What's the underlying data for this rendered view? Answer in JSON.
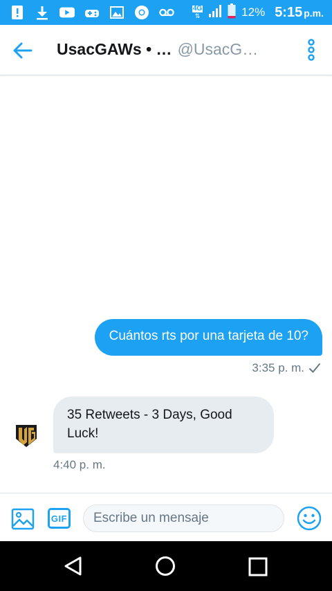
{
  "status_bar": {
    "icons": [
      "alert-icon",
      "download-icon",
      "youtube-icon",
      "games-icon",
      "gallery-icon",
      "chrome-icon",
      "voicemail-icon",
      "network-4g-icon",
      "signal-icon",
      "battery-icon"
    ],
    "network_type": "4G",
    "battery_percent": "12%",
    "time": "5:15",
    "ampm": "p.m.",
    "background_color": "#1da1f2"
  },
  "header": {
    "name": "UsacGAWs • …",
    "handle": "@UsacG…",
    "back_icon": "back-arrow-icon",
    "more_icon": "more-vertical-icon"
  },
  "conversation": {
    "messages": [
      {
        "direction": "outgoing",
        "text": "Cuántos rts por una tarjeta de 10?",
        "time": "3:35 p. m.",
        "status_icon": "check-icon"
      },
      {
        "direction": "incoming",
        "text": "35 Retweets - 3 Days, Good Luck!",
        "time": "4:40 p. m.",
        "avatar_icon": "ug-logo-icon"
      }
    ]
  },
  "composer": {
    "image_icon": "image-icon",
    "gif_label": "GIF",
    "input_value": "",
    "input_placeholder": "Escribe un mensaje",
    "emoji_icon": "emoji-icon"
  },
  "nav_bar": {
    "icons": [
      "nav-back-icon",
      "nav-home-icon",
      "nav-recents-icon"
    ]
  },
  "colors": {
    "accent": "#1da1f2",
    "incoming_bubble": "#e6ecf0",
    "meta_text": "#657786"
  }
}
